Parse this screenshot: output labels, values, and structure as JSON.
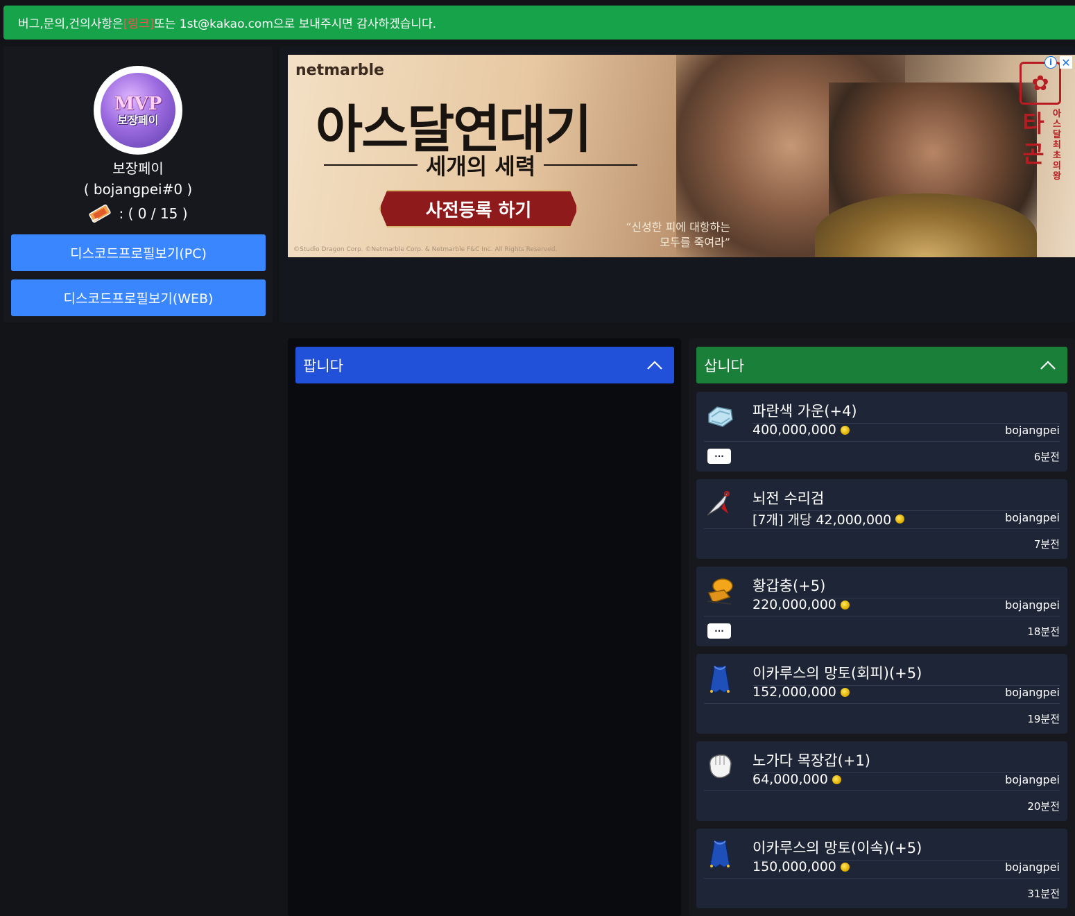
{
  "notice": {
    "prefix": "버그,문의,건의사항은",
    "link": "[링크]",
    "suffix": "또는 1st@kakao.com으로 보내주시면 감사하겠습니다."
  },
  "profile": {
    "avatar_logo": "MVP",
    "avatar_name": "보장페이",
    "name": "보장페이",
    "tag": "( bojangpei#0 )",
    "ticket": ": ( 0 / 15 )",
    "btn_pc": "디스코드프로필보기(PC)",
    "btn_web": "디스코드프로필보기(WEB)"
  },
  "ad": {
    "brand": "netmarble",
    "title": "아스달연대기",
    "subtitle": "세개의 세력",
    "cta": "사전등록 하기",
    "quote1": "“신성한 피에 대항하는",
    "quote2": "모두를 죽여라”",
    "copyright": "©Studio Dragon Corp. ©Netmarble Corp. & Netmarble F&C Inc. All Rights Reserved.",
    "game_name": "타곤",
    "game_tagline": "아스달최초의왕",
    "info_icon": "i",
    "close_icon": "✕"
  },
  "sell": {
    "title": "팝니다"
  },
  "buy": {
    "title": "삽니다",
    "items": [
      {
        "name": "파란색 가운(+4)",
        "price": "400,000,000",
        "seller": "bojangpei",
        "time": "6분전",
        "more": "···",
        "icon": "blue-gown-icon"
      },
      {
        "name": "뇌전 수리검",
        "price": "[7개] 개당 42,000,000",
        "seller": "bojangpei",
        "time": "7분전",
        "more": "",
        "icon": "throwing-star-icon"
      },
      {
        "name": "황갑충(+5)",
        "price": "220,000,000",
        "seller": "bojangpei",
        "time": "18분전",
        "more": "···",
        "icon": "beetle-icon"
      },
      {
        "name": "이카루스의 망토(회피)(+5)",
        "price": "152,000,000",
        "seller": "bojangpei",
        "time": "19분전",
        "more": "",
        "icon": "blue-cape-icon"
      },
      {
        "name": "노가다 목장갑(+1)",
        "price": "64,000,000",
        "seller": "bojangpei",
        "time": "20분전",
        "more": "",
        "icon": "white-glove-icon"
      },
      {
        "name": "이카루스의 망토(이속)(+5)",
        "price": "150,000,000",
        "seller": "bojangpei",
        "time": "31분전",
        "more": "",
        "icon": "blue-cape-icon"
      }
    ]
  },
  "colors": {
    "notice": "#17a34a",
    "link": "#ff4d4d",
    "profile_btn": "#3a86ff",
    "sell_header": "#2251d9",
    "buy_header": "#1a7f38",
    "card": "#1e2537"
  }
}
